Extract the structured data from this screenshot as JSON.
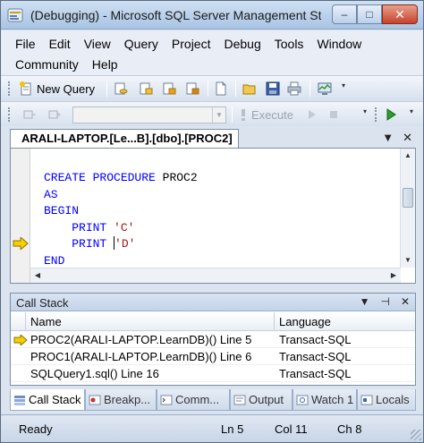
{
  "window": {
    "title": "(Debugging) - Microsoft SQL Server Management St...",
    "controls": {
      "minimize": "–",
      "maximize": "□",
      "close": "✕"
    }
  },
  "menu": {
    "row1": [
      "File",
      "Edit",
      "View",
      "Query",
      "Project",
      "Debug",
      "Tools",
      "Window"
    ],
    "row2": [
      "Community",
      "Help"
    ]
  },
  "toolbar1": {
    "new_query_label": "New Query"
  },
  "toolbar2": {
    "execute_label": "Execute",
    "database_combo_value": ""
  },
  "document": {
    "tab_label": "ARALI-LAPTOP.[Le...B].[dbo].[PROC2]",
    "tab_tools": {
      "dropdown": "▼",
      "close": "✕"
    },
    "code": {
      "line1_kw1": "CREATE",
      "line1_kw2": "PROCEDURE",
      "line1_name": "PROC2",
      "line2": "AS",
      "line3": "BEGIN",
      "line4_kw": "PRINT",
      "line4_str": "'C'",
      "line5_kw": "PRINT",
      "line5_str_quote": "'",
      "line5_str_rest": "D'",
      "line6": "END"
    }
  },
  "call_stack": {
    "title": "Call Stack",
    "tools": {
      "dropdown": "▼",
      "pin": "⊣",
      "close": "✕"
    },
    "columns": [
      "Name",
      "Language"
    ],
    "rows": [
      {
        "name": "PROC2(ARALI-LAPTOP.LearnDB)() Line 5",
        "language": "Transact-SQL",
        "current": true
      },
      {
        "name": "PROC1(ARALI-LAPTOP.LearnDB)() Line 6",
        "language": "Transact-SQL",
        "current": false
      },
      {
        "name": "SQLQuery1.sql() Line 16",
        "language": "Transact-SQL",
        "current": false
      }
    ]
  },
  "bottom_tabs": [
    "Call Stack",
    "Breakp...",
    "Comm...",
    "Output",
    "Watch 1",
    "Locals"
  ],
  "status": {
    "state": "Ready",
    "ln": "Ln 5",
    "col": "Col 11",
    "ch": "Ch 8"
  },
  "colors": {
    "keyword": "#0000ff",
    "string": "#a31515",
    "exec_arrow": "#f5d000"
  }
}
